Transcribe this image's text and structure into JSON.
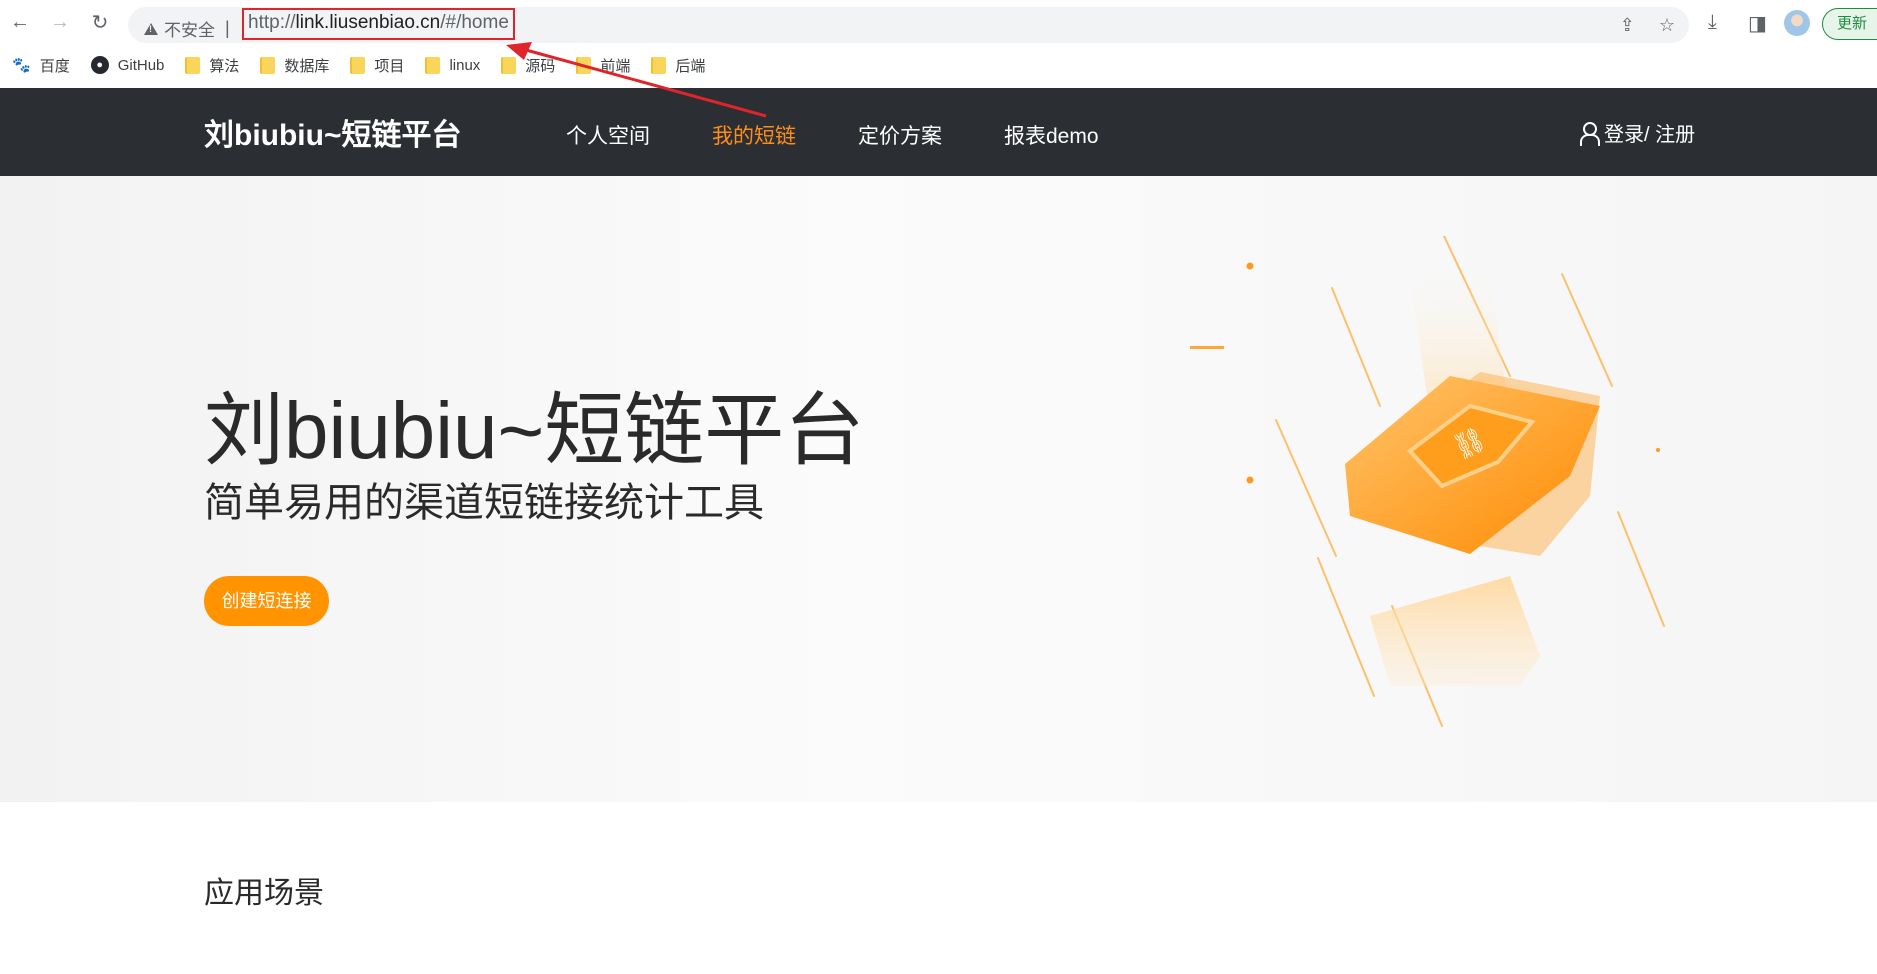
{
  "browser": {
    "security_label": "不安全",
    "url_prefix": "http://",
    "url_host": "link.liusenbiao.cn",
    "url_path": "/#/home",
    "update_label": "更新"
  },
  "bookmarks": [
    {
      "label": "百度",
      "icon": "baidu-icon"
    },
    {
      "label": "GitHub",
      "icon": "github-icon"
    },
    {
      "label": "算法",
      "icon": "folder-icon"
    },
    {
      "label": "数据库",
      "icon": "folder-icon"
    },
    {
      "label": "项目",
      "icon": "folder-icon"
    },
    {
      "label": "linux",
      "icon": "folder-icon"
    },
    {
      "label": "源码",
      "icon": "folder-icon"
    },
    {
      "label": "前端",
      "icon": "folder-icon"
    },
    {
      "label": "后端",
      "icon": "folder-icon"
    }
  ],
  "site": {
    "brand": "刘biubiu~短链平台",
    "menu": [
      "个人空间",
      "我的短链",
      "定价方案",
      "报表demo"
    ],
    "active_menu": "我的短链",
    "login": "登录/ 注册"
  },
  "hero": {
    "title": "刘biubiu~短链平台",
    "subtitle": "简单易用的渠道短链接统计工具",
    "cta": "创建短连接"
  },
  "section": {
    "title": "应用场景"
  },
  "colors": {
    "nav_bg": "#2b2f33",
    "accent": "#ff8d1a",
    "cta_bg": "#ff9400",
    "annotation_red": "#e0242c"
  }
}
